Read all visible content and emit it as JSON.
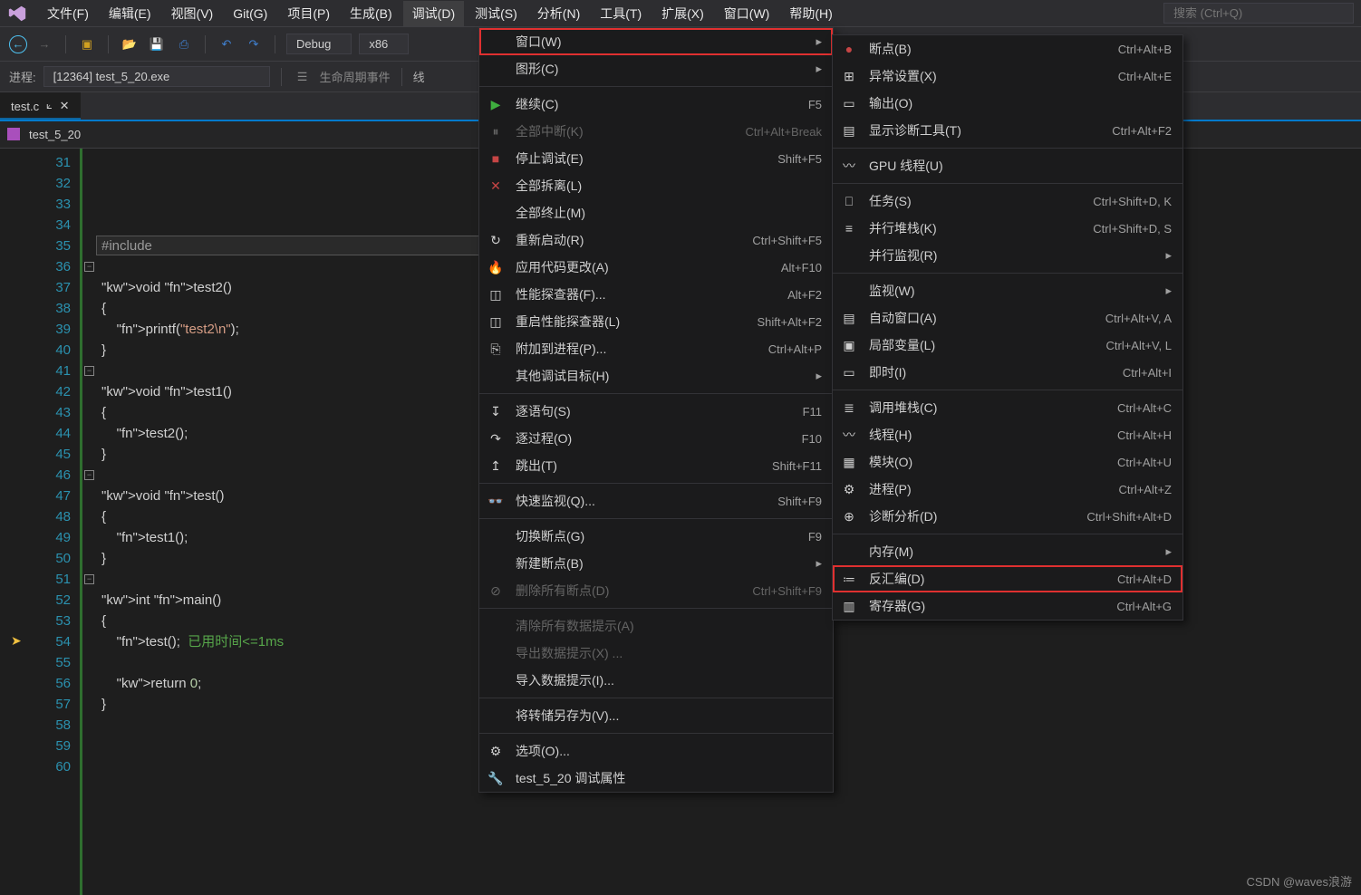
{
  "menubar": {
    "items": [
      "文件(F)",
      "编辑(E)",
      "视图(V)",
      "Git(G)",
      "项目(P)",
      "生成(B)",
      "调试(D)",
      "测试(S)",
      "分析(N)",
      "工具(T)",
      "扩展(X)",
      "窗口(W)",
      "帮助(H)"
    ],
    "active_index": 6,
    "search_placeholder": "搜索 (Ctrl+Q)"
  },
  "toolbar1": {
    "config": "Debug",
    "platform": "x86"
  },
  "toolbar2": {
    "process_label": "进程:",
    "process_value": "[12364] test_5_20.exe",
    "lifecycle": "生命周期事件",
    "thread_label": "线"
  },
  "tab": {
    "name": "test.c"
  },
  "crumb": {
    "project": "test_5_20"
  },
  "editor": {
    "first_line": 31,
    "lines": [
      "",
      "",
      "",
      "",
      "#include <stdio.h>",
      "",
      "void test2()",
      "{",
      "    printf(\"test2\\n\");",
      "}",
      "",
      "void test1()",
      "{",
      "    test2();",
      "}",
      "",
      "void test()",
      "{",
      "    test1();",
      "}",
      "",
      "int main()",
      "{",
      "    test();  已用时间<=1ms",
      "",
      "    return 0;",
      "}",
      "",
      "",
      ""
    ],
    "folds": [
      36,
      41,
      46,
      51
    ],
    "current_line_index": 23,
    "highlight_line_index": 4
  },
  "menu1": [
    {
      "icon": "",
      "label": "窗口(W)",
      "shortcut": "",
      "arrow": true,
      "highlighted": true
    },
    {
      "icon": "",
      "label": "图形(C)",
      "shortcut": "",
      "arrow": true
    },
    {
      "sep": true
    },
    {
      "icon": "▶",
      "iconColor": "#3fae3f",
      "label": "继续(C)",
      "shortcut": "F5"
    },
    {
      "icon": "⏸",
      "label": "全部中断(K)",
      "shortcut": "Ctrl+Alt+Break",
      "disabled": true
    },
    {
      "icon": "■",
      "iconColor": "#c64545",
      "label": "停止调试(E)",
      "shortcut": "Shift+F5"
    },
    {
      "icon": "✕",
      "iconColor": "#c64545",
      "label": "全部拆离(L)",
      "shortcut": ""
    },
    {
      "icon": "",
      "label": "全部终止(M)",
      "shortcut": ""
    },
    {
      "icon": "↻",
      "label": "重新启动(R)",
      "shortcut": "Ctrl+Shift+F5"
    },
    {
      "icon": "🔥",
      "iconColor": "#d66a2a",
      "label": "应用代码更改(A)",
      "shortcut": "Alt+F10"
    },
    {
      "icon": "◫",
      "label": "性能探查器(F)...",
      "shortcut": "Alt+F2"
    },
    {
      "icon": "◫",
      "label": "重启性能探查器(L)",
      "shortcut": "Shift+Alt+F2"
    },
    {
      "icon": "⎘",
      "label": "附加到进程(P)...",
      "shortcut": "Ctrl+Alt+P"
    },
    {
      "icon": "",
      "label": "其他调试目标(H)",
      "shortcut": "",
      "arrow": true
    },
    {
      "sep": true
    },
    {
      "icon": "↧",
      "label": "逐语句(S)",
      "shortcut": "F11"
    },
    {
      "icon": "↷",
      "label": "逐过程(O)",
      "shortcut": "F10"
    },
    {
      "icon": "↥",
      "label": "跳出(T)",
      "shortcut": "Shift+F11"
    },
    {
      "sep": true
    },
    {
      "icon": "👓",
      "label": "快速监视(Q)...",
      "shortcut": "Shift+F9"
    },
    {
      "sep": true
    },
    {
      "icon": "",
      "label": "切换断点(G)",
      "shortcut": "F9"
    },
    {
      "icon": "",
      "label": "新建断点(B)",
      "shortcut": "",
      "arrow": true
    },
    {
      "icon": "⊘",
      "label": "删除所有断点(D)",
      "shortcut": "Ctrl+Shift+F9",
      "disabled": true
    },
    {
      "sep": true
    },
    {
      "icon": "",
      "label": "清除所有数据提示(A)",
      "shortcut": "",
      "disabled": true
    },
    {
      "icon": "",
      "label": "导出数据提示(X) ...",
      "shortcut": "",
      "disabled": true
    },
    {
      "icon": "",
      "label": "导入数据提示(I)...",
      "shortcut": ""
    },
    {
      "sep": true
    },
    {
      "icon": "",
      "label": "将转储另存为(V)...",
      "shortcut": ""
    },
    {
      "sep": true
    },
    {
      "icon": "⚙",
      "label": "选项(O)...",
      "shortcut": ""
    },
    {
      "icon": "🔧",
      "label": "test_5_20 调试属性",
      "shortcut": ""
    }
  ],
  "menu2": [
    {
      "icon": "●",
      "iconColor": "#c64545",
      "label": "断点(B)",
      "shortcut": "Ctrl+Alt+B"
    },
    {
      "icon": "⊞",
      "label": "异常设置(X)",
      "shortcut": "Ctrl+Alt+E"
    },
    {
      "icon": "▭",
      "label": "输出(O)",
      "shortcut": ""
    },
    {
      "icon": "▤",
      "label": "显示诊断工具(T)",
      "shortcut": "Ctrl+Alt+F2"
    },
    {
      "sep": true
    },
    {
      "icon": "〰",
      "label": "GPU 线程(U)",
      "shortcut": ""
    },
    {
      "sep": true
    },
    {
      "icon": "⎕",
      "label": "任务(S)",
      "shortcut": "Ctrl+Shift+D, K"
    },
    {
      "icon": "≡",
      "label": "并行堆栈(K)",
      "shortcut": "Ctrl+Shift+D, S"
    },
    {
      "icon": "",
      "label": "并行监视(R)",
      "shortcut": "",
      "arrow": true
    },
    {
      "sep": true
    },
    {
      "icon": "",
      "label": "监视(W)",
      "shortcut": "",
      "arrow": true
    },
    {
      "icon": "▤",
      "label": "自动窗口(A)",
      "shortcut": "Ctrl+Alt+V, A"
    },
    {
      "icon": "▣",
      "label": "局部变量(L)",
      "shortcut": "Ctrl+Alt+V, L"
    },
    {
      "icon": "▭",
      "label": "即时(I)",
      "shortcut": "Ctrl+Alt+I"
    },
    {
      "sep": true
    },
    {
      "icon": "≣",
      "label": "调用堆栈(C)",
      "shortcut": "Ctrl+Alt+C"
    },
    {
      "icon": "〰",
      "label": "线程(H)",
      "shortcut": "Ctrl+Alt+H"
    },
    {
      "icon": "▦",
      "label": "模块(O)",
      "shortcut": "Ctrl+Alt+U"
    },
    {
      "icon": "⚙",
      "label": "进程(P)",
      "shortcut": "Ctrl+Alt+Z"
    },
    {
      "icon": "⊕",
      "label": "诊断分析(D)",
      "shortcut": "Ctrl+Shift+Alt+D"
    },
    {
      "sep": true
    },
    {
      "icon": "",
      "label": "内存(M)",
      "shortcut": "",
      "arrow": true
    },
    {
      "icon": "≔",
      "label": "反汇编(D)",
      "shortcut": "Ctrl+Alt+D",
      "highlighted": true
    },
    {
      "icon": "▥",
      "label": "寄存器(G)",
      "shortcut": "Ctrl+Alt+G"
    }
  ],
  "watermark": "CSDN @waves浪游"
}
